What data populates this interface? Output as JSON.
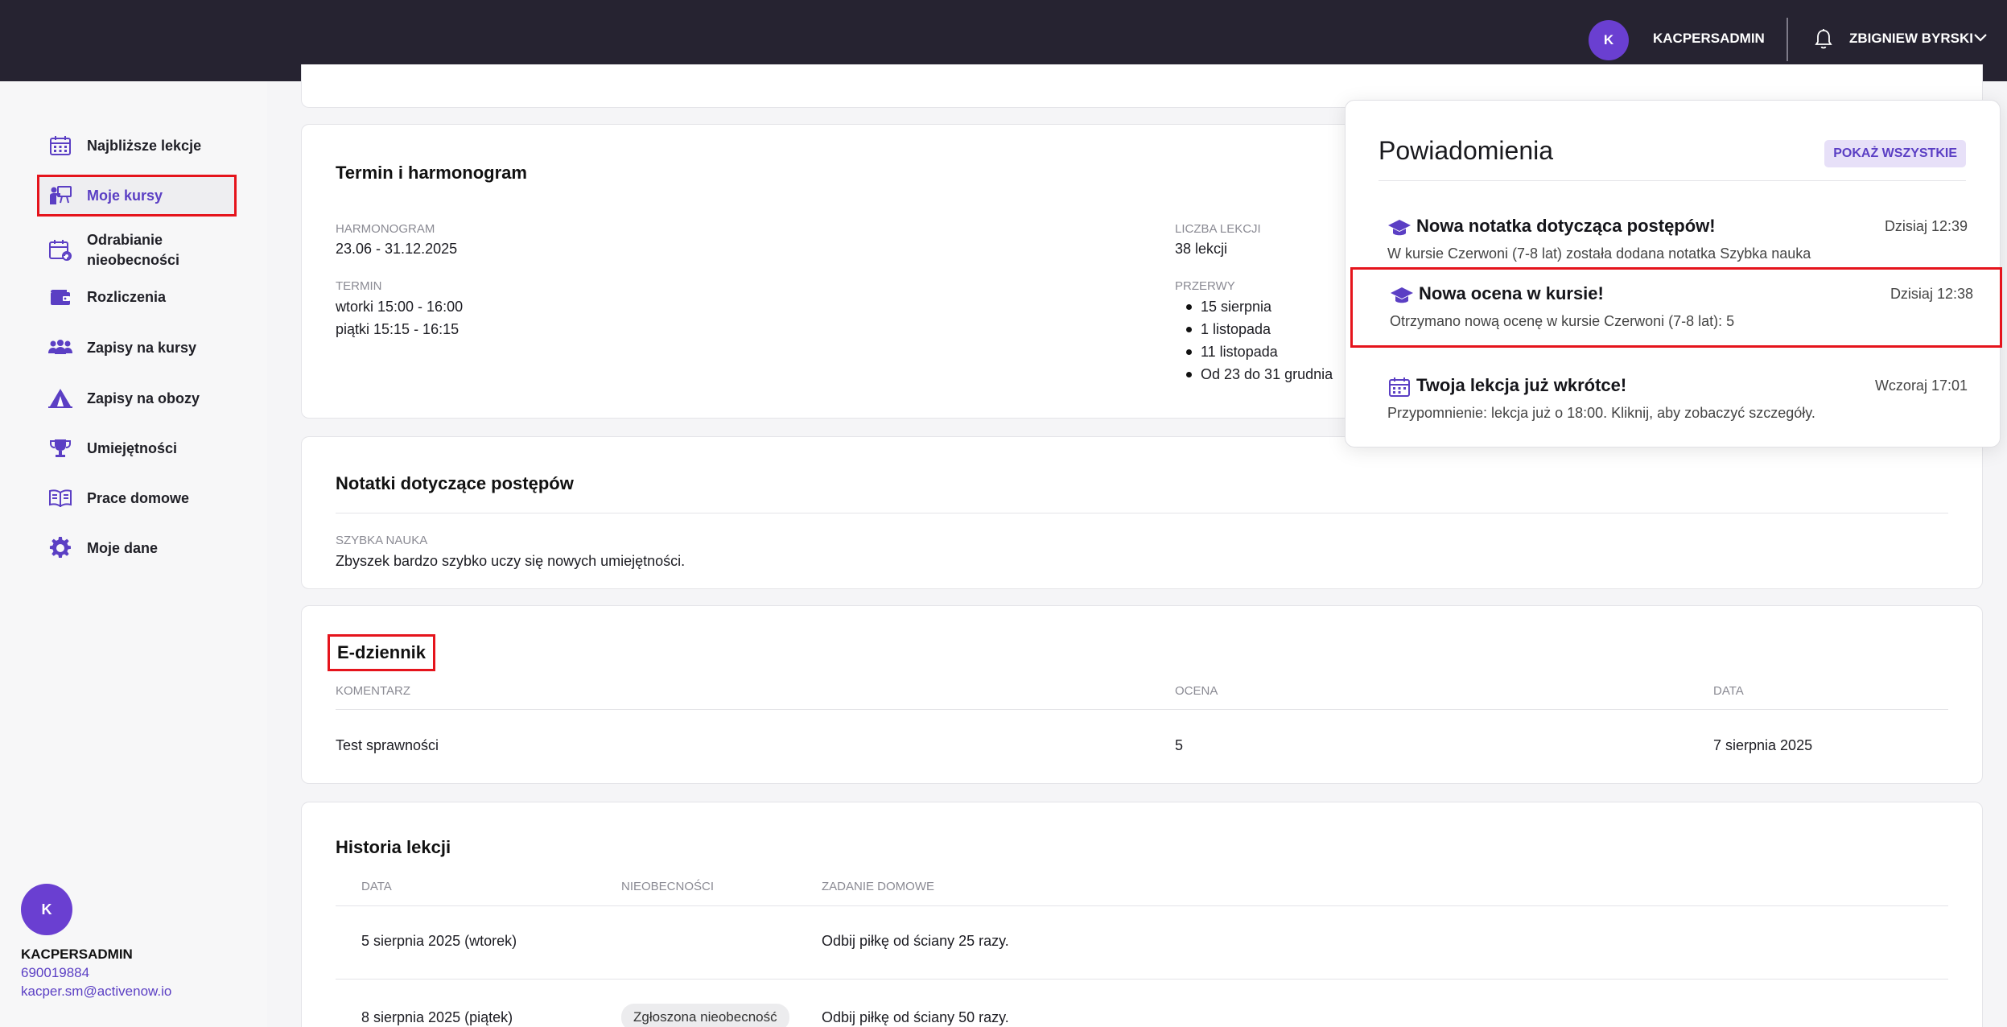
{
  "topbar": {
    "avatar_letter": "K",
    "account_name": "KACPERSADMIN",
    "user_name": "ZBIGNIEW BYRSKI",
    "icons": [
      "bell-icon",
      "chevron-down-icon"
    ]
  },
  "sidebar": {
    "items": [
      {
        "label": "Najbliższe lekcje",
        "icon": "calendar-icon"
      },
      {
        "label": "Moje kursy",
        "icon": "teacher-board-icon",
        "active": true
      },
      {
        "label": "Odrabianie nieobecności",
        "icon": "calendar-refresh-icon"
      },
      {
        "label": "Rozliczenia",
        "icon": "wallet-icon"
      },
      {
        "label": "Zapisy na kursy",
        "icon": "people-icon"
      },
      {
        "label": "Zapisy na obozy",
        "icon": "tent-icon"
      },
      {
        "label": "Umiejętności",
        "icon": "trophy-icon"
      },
      {
        "label": "Prace domowe",
        "icon": "book-icon"
      },
      {
        "label": "Moje dane",
        "icon": "gear-icon"
      }
    ],
    "user": {
      "avatar_letter": "K",
      "name": "KACPERSADMIN",
      "phone": "690019884",
      "email": "kacper.sm@activenow.io"
    }
  },
  "schedule": {
    "title": "Termin i harmonogram",
    "harmonogram_label": "HARMONOGRAM",
    "harmonogram_value": "23.06 - 31.12.2025",
    "termin_label": "TERMIN",
    "termin_values": [
      "wtorki 15:00 - 16:00",
      "piątki 15:15 - 16:15"
    ],
    "lessons_label": "LICZBA LEKCJI",
    "lessons_value": "38 lekcji",
    "breaks_label": "PRZERWY",
    "breaks": [
      "15 sierpnia",
      "1 listopada",
      "11 listopada",
      "Od 23 do 31 grudnia"
    ]
  },
  "notes": {
    "title": "Notatki dotyczące postępów",
    "note_label": "SZYBKA NAUKA",
    "note_text": "Zbyszek bardzo szybko uczy się nowych umiejętności."
  },
  "ediary": {
    "title": "E-dziennik",
    "columns": [
      "KOMENTARZ",
      "OCENA",
      "DATA"
    ],
    "rows": [
      {
        "comment": "Test sprawności",
        "grade": "5",
        "date": "7 sierpnia 2025"
      }
    ]
  },
  "history": {
    "title": "Historia lekcji",
    "columns": [
      "DATA",
      "NIEOBECNOŚCI",
      "ZADANIE DOMOWE"
    ],
    "rows": [
      {
        "date": "5 sierpnia 2025 (wtorek)",
        "absence": "",
        "homework": "Odbij piłkę od ściany 25 razy."
      },
      {
        "date": "8 sierpnia 2025 (piątek)",
        "absence": "Zgłoszona nieobecność",
        "homework": "Odbij piłkę od ściany 50 razy."
      }
    ]
  },
  "notifications": {
    "title": "Powiadomienia",
    "show_all": "POKAŻ WSZYSTKIE",
    "items": [
      {
        "icon": "graduation-cap-icon",
        "title": "Nowa notatka dotycząca postępów!",
        "time": "Dzisiaj 12:39",
        "body": "W kursie Czerwoni (7-8 lat) została dodana notatka Szybka nauka"
      },
      {
        "icon": "graduation-cap-icon",
        "title": "Nowa ocena w kursie!",
        "time": "Dzisiaj 12:38",
        "body": "Otrzymano nową ocenę w kursie Czerwoni (7-8 lat): 5",
        "highlighted": true
      },
      {
        "icon": "calendar-icon",
        "title": "Twoja lekcja już wkrótce!",
        "time": "Wczoraj 17:01",
        "body": "Przypomnienie: lekcja już o 18:00. Kliknij, aby zobaczyć szczegóły."
      }
    ]
  },
  "colors": {
    "topbar_bg": "#262331",
    "accent": "#5b3fc4",
    "avatar": "#6a3fd1",
    "highlight_border": "#e5141c"
  }
}
